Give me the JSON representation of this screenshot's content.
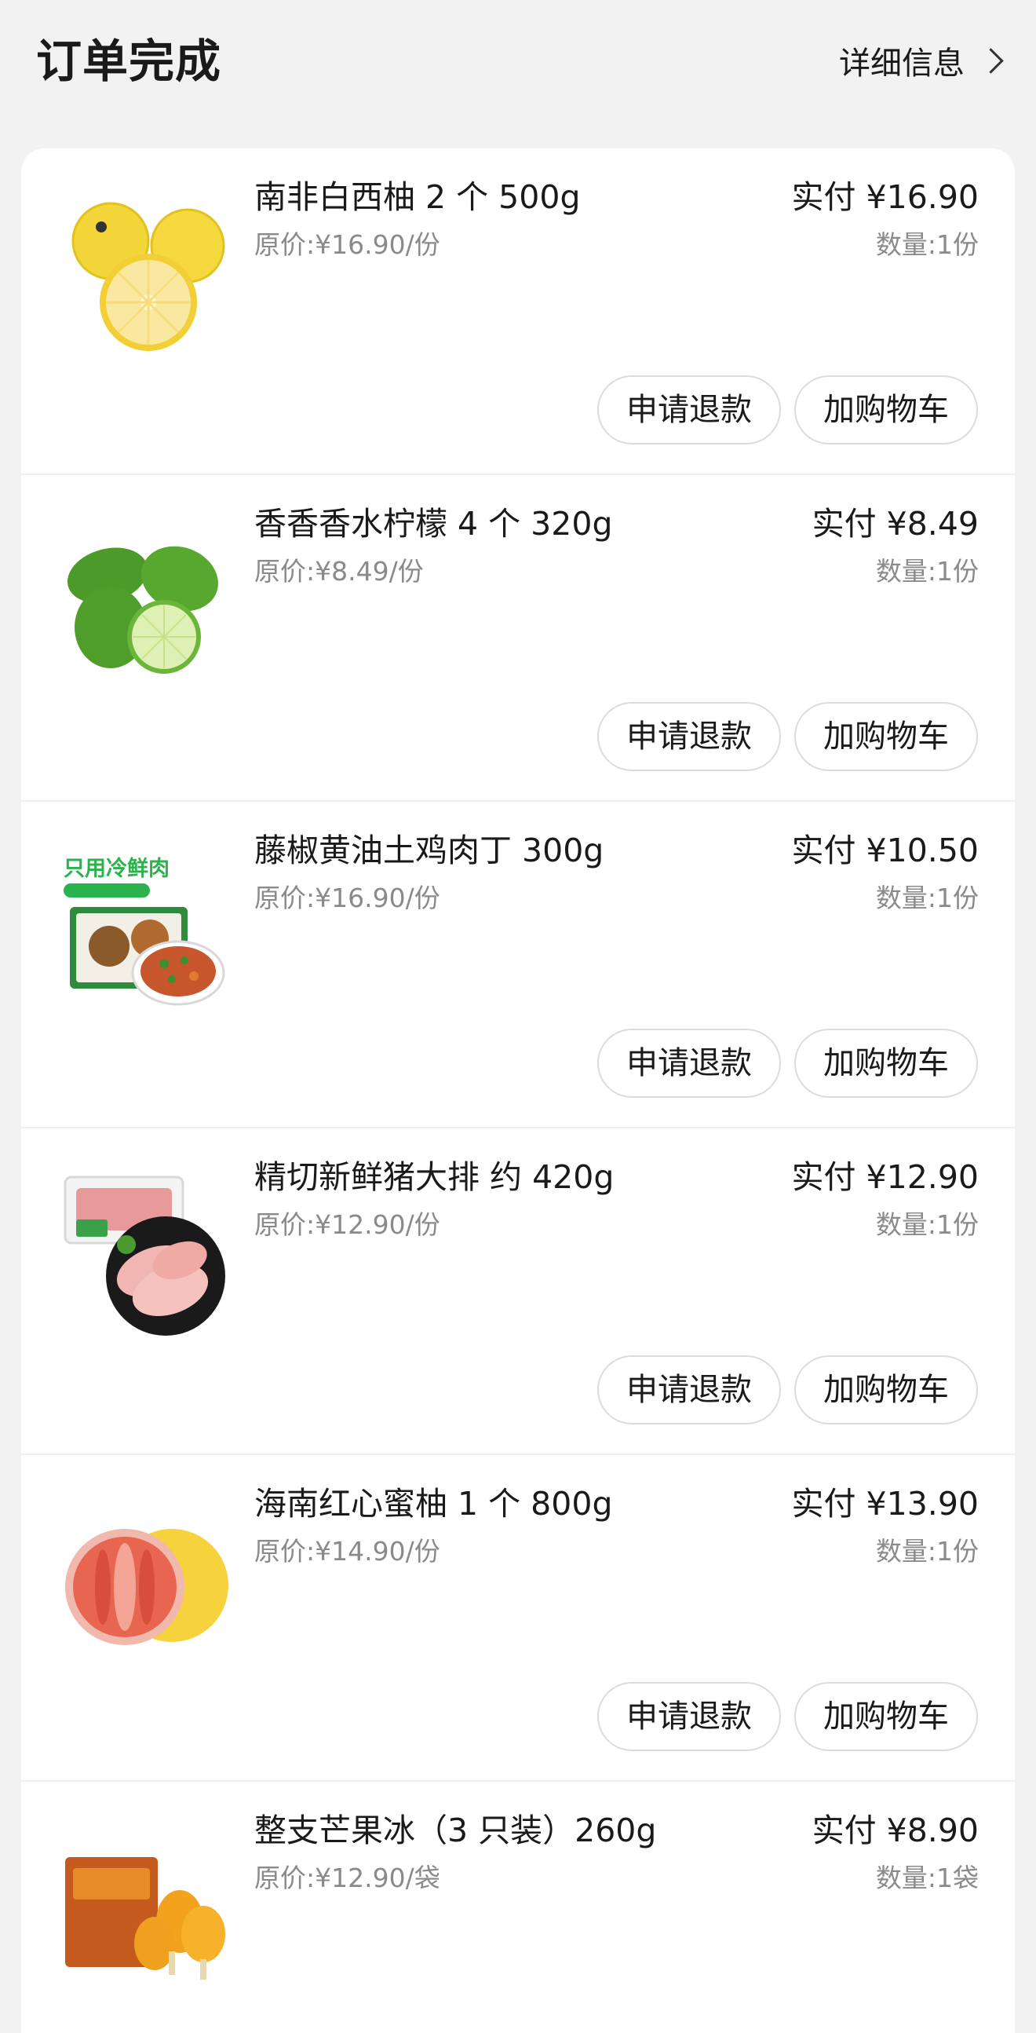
{
  "header": {
    "title": "订单完成",
    "details_label": "详细信息"
  },
  "items": [
    {
      "name": "南非白西柚 2 个 500g",
      "original_price": "原价:¥16.90/份",
      "paid": "实付 ¥16.90",
      "quantity": "数量:1份",
      "refund_label": "申请退款",
      "cart_label": "加购物车"
    },
    {
      "name": "香香香水柠檬 4 个 320g",
      "original_price": "原价:¥8.49/份",
      "paid": "实付 ¥8.49",
      "quantity": "数量:1份",
      "refund_label": "申请退款",
      "cart_label": "加购物车"
    },
    {
      "name": "藤椒黄油土鸡肉丁 300g",
      "original_price": "原价:¥16.90/份",
      "paid": "实付 ¥10.50",
      "quantity": "数量:1份",
      "refund_label": "申请退款",
      "cart_label": "加购物车",
      "image_text": "只用冷鲜肉"
    },
    {
      "name": "精切新鲜猪大排 约 420g",
      "original_price": "原价:¥12.90/份",
      "paid": "实付 ¥12.90",
      "quantity": "数量:1份",
      "refund_label": "申请退款",
      "cart_label": "加购物车"
    },
    {
      "name": "海南红心蜜柚 1 个 800g",
      "original_price": "原价:¥14.90/份",
      "paid": "实付 ¥13.90",
      "quantity": "数量:1份",
      "refund_label": "申请退款",
      "cart_label": "加购物车"
    },
    {
      "name": "整支芒果冰（3 只装）260g",
      "original_price": "原价:¥12.90/袋",
      "paid": "实付 ¥8.90",
      "quantity": "数量:1袋"
    }
  ],
  "icons": {
    "details": "chevron-right-icon",
    "item_images": [
      "grapefruit-image",
      "lemon-image",
      "chicken-dish-image",
      "pork-chop-image",
      "pomelo-image",
      "mango-popsicle-image"
    ]
  },
  "colors": {
    "background": "#f2f2f2",
    "card": "#ffffff",
    "secondary_text": "#8a8a8a",
    "button_border": "#dcdcdc",
    "image_label_green": "#2bb24c"
  }
}
